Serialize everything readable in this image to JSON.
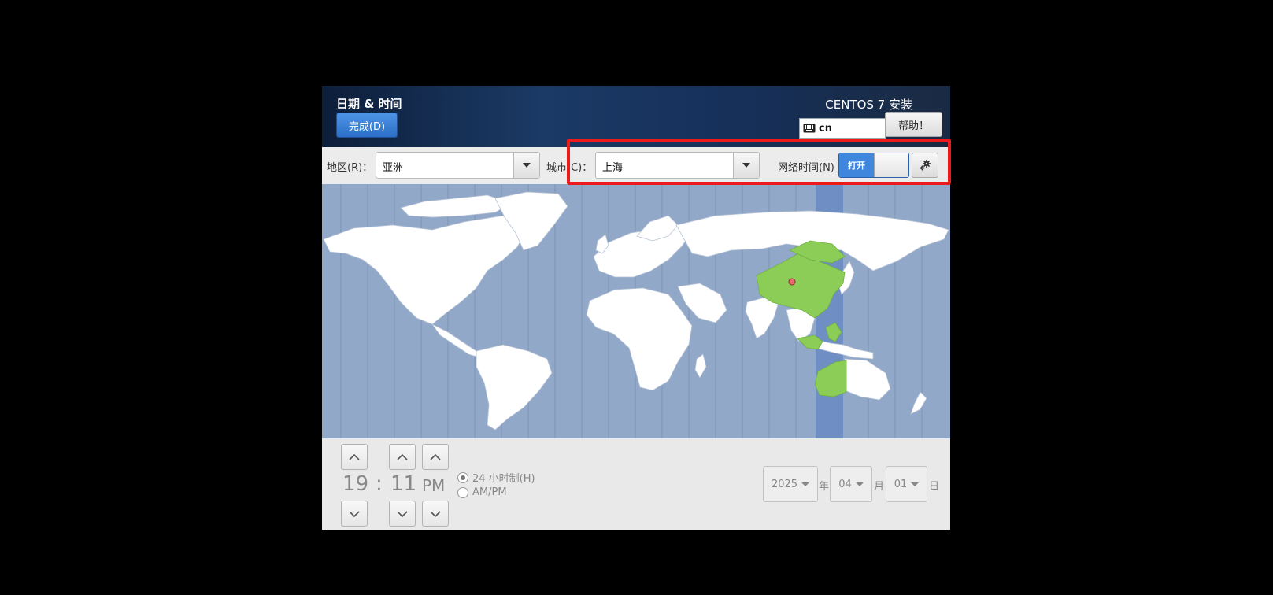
{
  "header": {
    "title": "日期 & 时间",
    "done_label": "完成(D)",
    "product": "CENTOS 7 安装",
    "keyboard_layout": "cn",
    "help_label": "帮助！"
  },
  "toolbar": {
    "region_label": "地区(R)：",
    "region_value": "亚洲",
    "city_label": "城市(C)：",
    "city_value": "上海",
    "ntp_label": "网络时间(N)",
    "ntp_on_label": "打开"
  },
  "time": {
    "hours": "19",
    "separator": ":",
    "minutes": "11",
    "ampm": "PM",
    "format_24h": "24 小时制(H)",
    "format_ampm": "AM/PM",
    "selected_format": "24h"
  },
  "date": {
    "year": "2025",
    "year_suffix": "年",
    "month": "04",
    "month_suffix": "月",
    "day": "01",
    "day_suffix": "日"
  },
  "colors": {
    "map_ocean": "#92a8c9",
    "map_land": "#ffffff",
    "selected_zone_land": "#8ccd58",
    "selected_zone_band": "#6f8fc4",
    "highlight_box": "#ee1a1a",
    "switch_on": "#3f86dc"
  }
}
